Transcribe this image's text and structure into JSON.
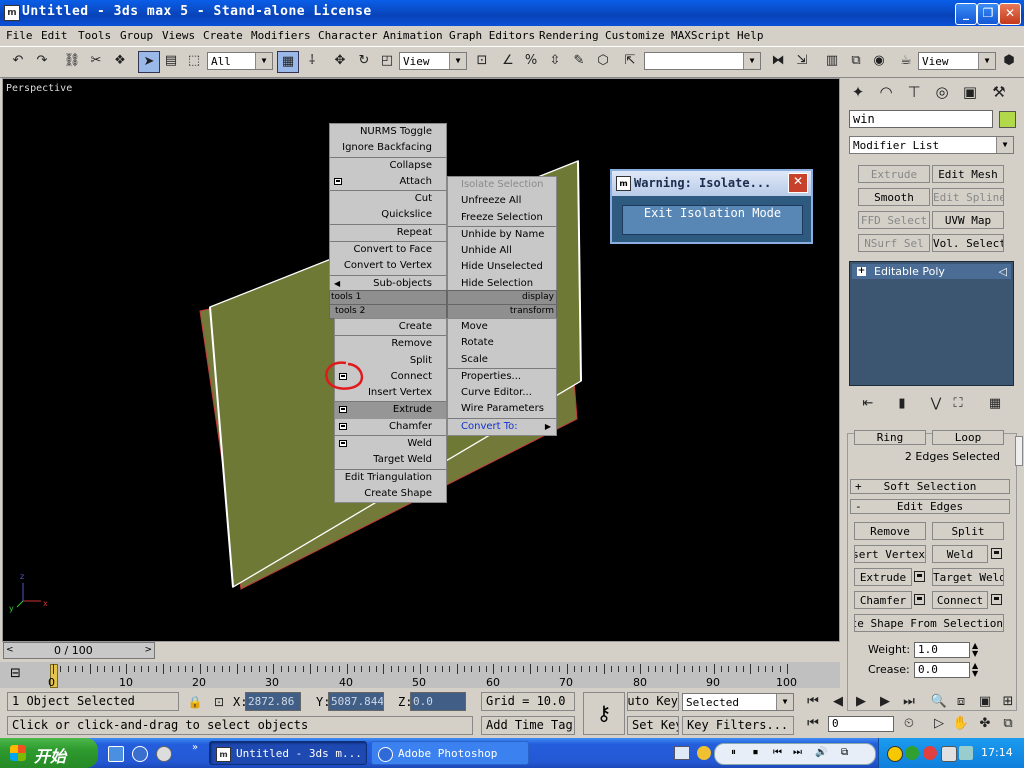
{
  "window": {
    "title": "Untitled - 3ds max 5 - Stand-alone License",
    "app_icon": "max-icon",
    "controls": [
      "minimize",
      "maximize",
      "close"
    ]
  },
  "menu": [
    "File",
    "Edit",
    "Tools",
    "Group",
    "Views",
    "Create",
    "Modifiers",
    "Character",
    "Animation",
    "Graph Editors",
    "Rendering",
    "Customize",
    "MAXScript",
    "Help"
  ],
  "toolbar": {
    "selection_filter": "All",
    "ref_coord_1": "View",
    "ref_coord_2": "View",
    "named_selection": ""
  },
  "viewport": {
    "label": "Perspective",
    "axis": {
      "x": "x",
      "y": "y",
      "z": "z"
    }
  },
  "quad_left": {
    "head_top": "tools 1",
    "head_bottom": "tools 2",
    "top_items": [
      "NURMS Toggle",
      "Ignore Backfacing",
      "Collapse",
      "Attach",
      "Cut",
      "Quickslice",
      "Repeat",
      "Convert to Face",
      "Convert to Vertex",
      "Sub-objects"
    ],
    "bottom_items": [
      "Create",
      "Remove",
      "Split",
      "Connect",
      "Insert Vertex",
      "Extrude",
      "Chamfer",
      "Weld",
      "Target Weld",
      "Edit Triangulation",
      "Create Shape"
    ]
  },
  "quad_right": {
    "head_top": "display",
    "head_bottom": "transform",
    "top_items": [
      "Isolate Selection",
      "Unfreeze All",
      "Freeze Selection",
      "Unhide by Name",
      "Unhide All",
      "Hide Unselected",
      "Hide Selection"
    ],
    "bottom_items": [
      "Move",
      "Rotate",
      "Scale",
      "Properties...",
      "Curve Editor...",
      "Wire Parameters",
      "Convert To:"
    ]
  },
  "warning": {
    "title": "Warning: Isolate...",
    "button": "Exit Isolation Mode"
  },
  "command_panel": {
    "object_name": "win",
    "object_color": "#b2d94a",
    "modifier_list": "Modifier List",
    "modifier_buttons": [
      "Extrude",
      "Edit Mesh",
      "Smooth",
      "Edit Spline",
      "FFD Select",
      "UVW Map",
      "NSurf Sel",
      "Vol. Select"
    ],
    "stack_item": "Editable Poly",
    "ring": "Ring",
    "loop": "Loop",
    "selection_info": "2 Edges Selected",
    "soft_selection": "Soft Selection",
    "edit_edges": "Edit Edges",
    "soft_sign": "+",
    "edit_sign": "-",
    "edge_buttons": [
      "Remove",
      "Split",
      "Insert Vertex",
      "Weld",
      "Extrude",
      "Target Weld",
      "Chamfer",
      "Connect"
    ],
    "create_shape": "Create Shape From Selection",
    "weight_label": "Weight:",
    "weight_value": "1.0",
    "crease_label": "Crease:",
    "crease_value": "0.0"
  },
  "timeline": {
    "frame": "0 / 100",
    "ticks": [
      "0",
      "10",
      "20",
      "30",
      "40",
      "50",
      "60",
      "70",
      "80",
      "90",
      "100"
    ]
  },
  "status": {
    "selection": "1 Object Selected",
    "prompt": "Click or click-and-drag to select objects",
    "x_label": "X:",
    "x_value": "2872.86",
    "y_label": "Y:",
    "y_value": "5087.844",
    "z_label": "Z:",
    "z_value": "0.0",
    "grid": "Grid = 10.0",
    "add_time_tag": "Add Time Tag",
    "auto_key": "Auto Key",
    "set_key": "Set Key",
    "key_mode": "Selected",
    "key_filters": "Key Filters...",
    "current_frame": "0"
  },
  "taskbar": {
    "start": "开始",
    "tasks": [
      "Untitled - 3ds m...",
      "Adobe Photoshop"
    ],
    "time": "17:14"
  }
}
